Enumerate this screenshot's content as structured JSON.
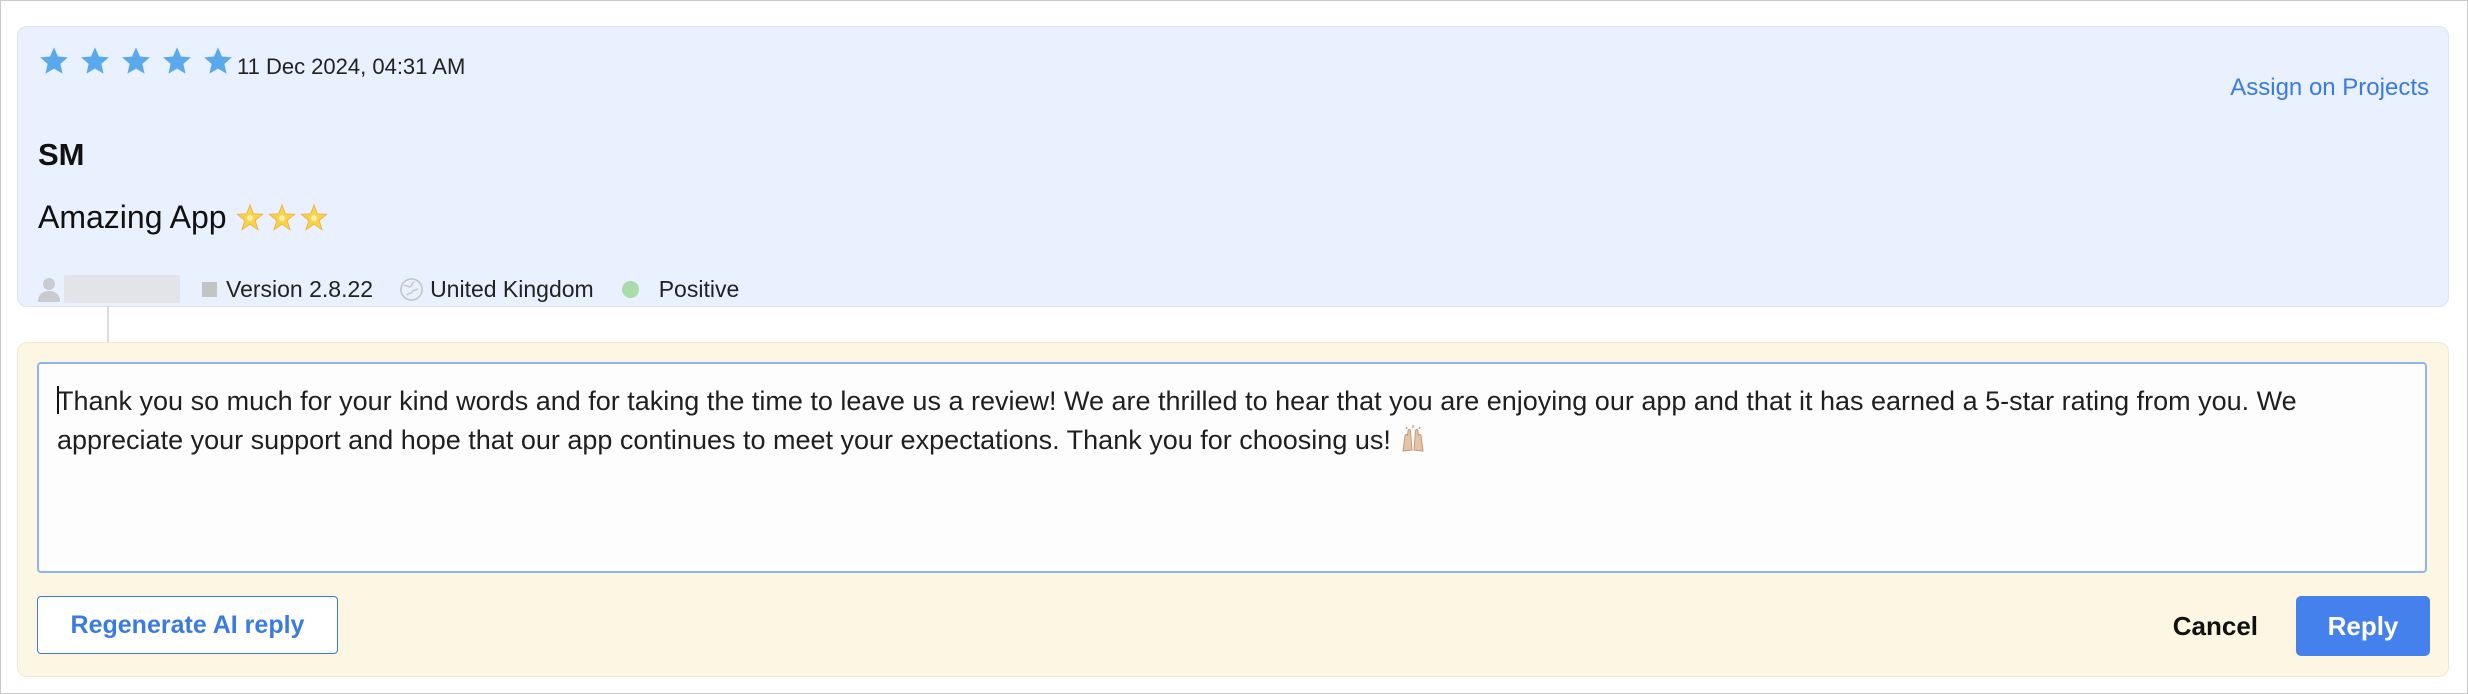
{
  "review": {
    "rating": 5,
    "rating_max": 5,
    "date": "11 Dec 2024, 04:31 AM",
    "assign_link": "Assign on Projects",
    "reviewer_name": "SM",
    "title": "Amazing App",
    "title_emoji": "sparkle-star-icon",
    "meta": {
      "version": "Version 2.8.22",
      "country": "United Kingdom",
      "sentiment": "Positive",
      "sentiment_color": "#a8dca8"
    }
  },
  "reply": {
    "text": "Thank you so much for your kind words and for taking the time to leave us a review! We are thrilled to hear that you are enjoying our app and that it has earned a 5-star rating from you. We appreciate your support and hope that our app continues to meet your expectations. Thank you for choosing us!",
    "trailing_emoji": "raised-hands-icon",
    "regenerate_label": "Regenerate AI reply",
    "cancel_label": "Cancel",
    "reply_label": "Reply"
  },
  "colors": {
    "accent": "#3a7be0",
    "reply_button": "#4581ec",
    "star": "#5aa9ec",
    "review_bg": "#e9f0fe",
    "reply_bg": "#fdf6e3"
  }
}
